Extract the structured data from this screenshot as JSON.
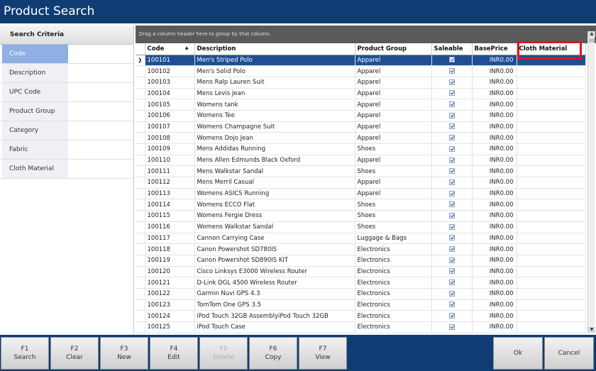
{
  "window": {
    "title": "Product Search"
  },
  "criteria": {
    "header": "Search Criteria",
    "items": [
      {
        "label": "Code",
        "value": ""
      },
      {
        "label": "Description",
        "value": ""
      },
      {
        "label": "UPC Code",
        "value": ""
      },
      {
        "label": "Product Group",
        "value": ""
      },
      {
        "label": "Category",
        "value": ""
      },
      {
        "label": "Fabric",
        "value": ""
      },
      {
        "label": "Cloth Material",
        "value": ""
      }
    ]
  },
  "grid": {
    "group_hint": "Drag a column header here to group by that column.",
    "columns": [
      "Code",
      "Description",
      "Product Group",
      "Saleable",
      "BasePrice",
      "Cloth Material"
    ],
    "sort_indicator": "▲",
    "row_indicator": "❯",
    "rows": [
      {
        "code": "100101",
        "description": "Men's  Striped Polo",
        "group": "Apparel",
        "price": "INR0.00",
        "material": ""
      },
      {
        "code": "100102",
        "description": "Men's Solid Polo",
        "group": "Apparel",
        "price": "INR0.00",
        "material": ""
      },
      {
        "code": "100103",
        "description": "Mens Ralp Lauren Suit",
        "group": "Apparel",
        "price": "INR0.00",
        "material": ""
      },
      {
        "code": "100104",
        "description": "Mens Levis Jean",
        "group": "Apparel",
        "price": "INR0.00",
        "material": ""
      },
      {
        "code": "100105",
        "description": "Womens tank",
        "group": "Apparel",
        "price": "INR0.00",
        "material": ""
      },
      {
        "code": "100106",
        "description": "Womens Tee",
        "group": "Apparel",
        "price": "INR0.00",
        "material": ""
      },
      {
        "code": "100107",
        "description": "Womens Champagne Suit",
        "group": "Apparel",
        "price": "INR0.00",
        "material": ""
      },
      {
        "code": "100108",
        "description": "Womens Dojo Jean",
        "group": "Apparel",
        "price": "INR0.00",
        "material": ""
      },
      {
        "code": "100109",
        "description": "Mens Addidas Running",
        "group": "Shoes",
        "price": "INR0.00",
        "material": ""
      },
      {
        "code": "100110",
        "description": "Mens Allen Edmunds Black Oxford",
        "group": "Apparel",
        "price": "INR0.00",
        "material": ""
      },
      {
        "code": "100111",
        "description": "Mens Walkstar Sandal",
        "group": "Shoes",
        "price": "INR0.00",
        "material": ""
      },
      {
        "code": "100112",
        "description": "Mens Merril Casual",
        "group": "Apparel",
        "price": "INR0.00",
        "material": ""
      },
      {
        "code": "100113",
        "description": "Womens ASICS Running",
        "group": "Apparel",
        "price": "INR0.00",
        "material": ""
      },
      {
        "code": "100114",
        "description": "Womens ECCO Flat",
        "group": "Shoes",
        "price": "INR0.00",
        "material": ""
      },
      {
        "code": "100115",
        "description": "Womens Fergie Dress",
        "group": "Shoes",
        "price": "INR0.00",
        "material": ""
      },
      {
        "code": "100116",
        "description": "Womens Walkstar Sandal",
        "group": "Shoes",
        "price": "INR0.00",
        "material": ""
      },
      {
        "code": "100117",
        "description": "Cannon Carrying Case",
        "group": "Luggage & Bags",
        "price": "INR0.00",
        "material": ""
      },
      {
        "code": "100118",
        "description": "Canon Powershot SD780IS",
        "group": "Electronics",
        "price": "INR0.00",
        "material": ""
      },
      {
        "code": "100119",
        "description": "Canon Powershot SD890IS KIT",
        "group": "Electronics",
        "price": "INR0.00",
        "material": ""
      },
      {
        "code": "100120",
        "description": "Cisco Linksys E3000 Wireless Router",
        "group": "Electronics",
        "price": "INR0.00",
        "material": ""
      },
      {
        "code": "100121",
        "description": "D-Link DGL 4500 Wireless Router",
        "group": "Electronics",
        "price": "INR0.00",
        "material": ""
      },
      {
        "code": "100122",
        "description": "Garmin Nuvi GPS 4.3",
        "group": "Electronics",
        "price": "INR0.00",
        "material": ""
      },
      {
        "code": "100123",
        "description": "TomTom One GPS 3.5",
        "group": "Electronics",
        "price": "INR0.00",
        "material": ""
      },
      {
        "code": "100124",
        "description": "iPod Touch 32GB AssemblyiPod Touch 32GB",
        "group": "Electronics",
        "price": "INR0.00",
        "material": ""
      },
      {
        "code": "100125",
        "description": "iPod Touch Case",
        "group": "Electronics",
        "price": "INR0.00",
        "material": ""
      }
    ]
  },
  "toolbar": {
    "f1": {
      "key": "F1",
      "label": "Search"
    },
    "f2": {
      "key": "F2",
      "label": "Clear"
    },
    "f3": {
      "key": "F3",
      "label": "New"
    },
    "f4": {
      "key": "F4",
      "label": "Edit"
    },
    "f5": {
      "key": "F5",
      "label": "Delete"
    },
    "f6": {
      "key": "F6",
      "label": "Copy"
    },
    "f7": {
      "key": "F7",
      "label": "View"
    },
    "ok": "Ok",
    "cancel": "Cancel"
  }
}
